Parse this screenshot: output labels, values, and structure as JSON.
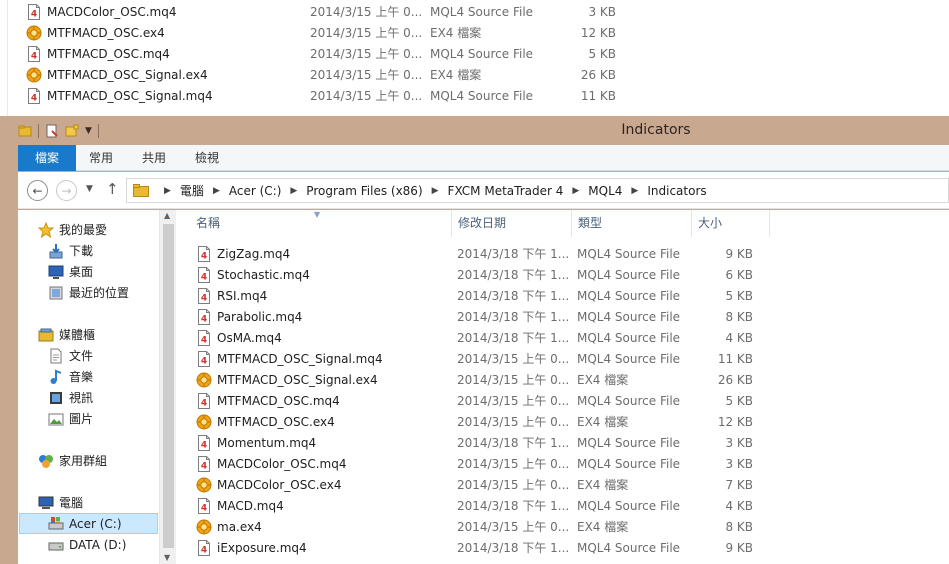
{
  "background_files": [
    {
      "name": "MACDColor_OSC.mq4",
      "date": "2014/3/15 上午 0...",
      "type": "MQL4 Source File",
      "size": "3 KB",
      "icon": "mq4-file-icon"
    },
    {
      "name": "MTFMACD_OSC.ex4",
      "date": "2014/3/15 上午 0...",
      "type": "EX4 檔案",
      "size": "12 KB",
      "icon": "ex4-file-icon"
    },
    {
      "name": "MTFMACD_OSC.mq4",
      "date": "2014/3/15 上午 0...",
      "type": "MQL4 Source File",
      "size": "5 KB",
      "icon": "mq4-file-icon"
    },
    {
      "name": "MTFMACD_OSC_Signal.ex4",
      "date": "2014/3/15 上午 0...",
      "type": "EX4 檔案",
      "size": "26 KB",
      "icon": "ex4-file-icon"
    },
    {
      "name": "MTFMACD_OSC_Signal.mq4",
      "date": "2014/3/15 上午 0...",
      "type": "MQL4 Source File",
      "size": "11 KB",
      "icon": "mq4-file-icon"
    }
  ],
  "window": {
    "title": "Indicators",
    "accent_color": "#1979ca",
    "frame_color": "#c9a890"
  },
  "ribbon": {
    "tabs": [
      "檔案",
      "常用",
      "共用",
      "檢視"
    ]
  },
  "address": {
    "crumbs": [
      "電腦",
      "Acer (C:)",
      "Program Files (x86)",
      "FXCM MetaTrader 4",
      "MQL4",
      "Indicators"
    ]
  },
  "nav_pane": {
    "items": [
      {
        "label": "我的最愛",
        "icon": "star-icon"
      },
      {
        "label": "下載",
        "icon": "downloads-icon"
      },
      {
        "label": "桌面",
        "icon": "desktop-icon"
      },
      {
        "label": "最近的位置",
        "icon": "recent-places-icon"
      },
      {
        "label": "媒體櫃",
        "icon": "libraries-icon"
      },
      {
        "label": "文件",
        "icon": "documents-icon"
      },
      {
        "label": "音樂",
        "icon": "music-icon"
      },
      {
        "label": "視訊",
        "icon": "videos-icon"
      },
      {
        "label": "圖片",
        "icon": "pictures-icon"
      },
      {
        "label": "家用群組",
        "icon": "homegroup-icon"
      },
      {
        "label": "電腦",
        "icon": "computer-icon"
      },
      {
        "label": "Acer (C:)",
        "icon": "drive-c-icon"
      },
      {
        "label": "DATA (D:)",
        "icon": "drive-d-icon"
      }
    ]
  },
  "columns": {
    "name": "名稱",
    "date": "修改日期",
    "type": "類型",
    "size": "大小"
  },
  "files": [
    {
      "name": "ZigZag.mq4",
      "date": "2014/3/18 下午 1...",
      "type": "MQL4 Source File",
      "size": "9 KB",
      "icon": "mq4-file-icon"
    },
    {
      "name": "Stochastic.mq4",
      "date": "2014/3/18 下午 1...",
      "type": "MQL4 Source File",
      "size": "6 KB",
      "icon": "mq4-file-icon"
    },
    {
      "name": "RSI.mq4",
      "date": "2014/3/18 下午 1...",
      "type": "MQL4 Source File",
      "size": "5 KB",
      "icon": "mq4-file-icon"
    },
    {
      "name": "Parabolic.mq4",
      "date": "2014/3/18 下午 1...",
      "type": "MQL4 Source File",
      "size": "8 KB",
      "icon": "mq4-file-icon"
    },
    {
      "name": "OsMA.mq4",
      "date": "2014/3/18 下午 1...",
      "type": "MQL4 Source File",
      "size": "4 KB",
      "icon": "mq4-file-icon"
    },
    {
      "name": "MTFMACD_OSC_Signal.mq4",
      "date": "2014/3/15 上午 0...",
      "type": "MQL4 Source File",
      "size": "11 KB",
      "icon": "mq4-file-icon"
    },
    {
      "name": "MTFMACD_OSC_Signal.ex4",
      "date": "2014/3/15 上午 0...",
      "type": "EX4 檔案",
      "size": "26 KB",
      "icon": "ex4-file-icon"
    },
    {
      "name": "MTFMACD_OSC.mq4",
      "date": "2014/3/15 上午 0...",
      "type": "MQL4 Source File",
      "size": "5 KB",
      "icon": "mq4-file-icon"
    },
    {
      "name": "MTFMACD_OSC.ex4",
      "date": "2014/3/15 上午 0...",
      "type": "EX4 檔案",
      "size": "12 KB",
      "icon": "ex4-file-icon"
    },
    {
      "name": "Momentum.mq4",
      "date": "2014/3/18 下午 1...",
      "type": "MQL4 Source File",
      "size": "3 KB",
      "icon": "mq4-file-icon"
    },
    {
      "name": "MACDColor_OSC.mq4",
      "date": "2014/3/15 上午 0...",
      "type": "MQL4 Source File",
      "size": "3 KB",
      "icon": "mq4-file-icon"
    },
    {
      "name": "MACDColor_OSC.ex4",
      "date": "2014/3/15 上午 0...",
      "type": "EX4 檔案",
      "size": "7 KB",
      "icon": "ex4-file-icon"
    },
    {
      "name": "MACD.mq4",
      "date": "2014/3/18 下午 1...",
      "type": "MQL4 Source File",
      "size": "4 KB",
      "icon": "mq4-file-icon"
    },
    {
      "name": "ma.ex4",
      "date": "2014/3/15 上午 0...",
      "type": "EX4 檔案",
      "size": "8 KB",
      "icon": "ex4-file-icon"
    },
    {
      "name": "iExposure.mq4",
      "date": "2014/3/18 下午 1...",
      "type": "MQL4 Source File",
      "size": "9 KB",
      "icon": "mq4-file-icon"
    }
  ]
}
